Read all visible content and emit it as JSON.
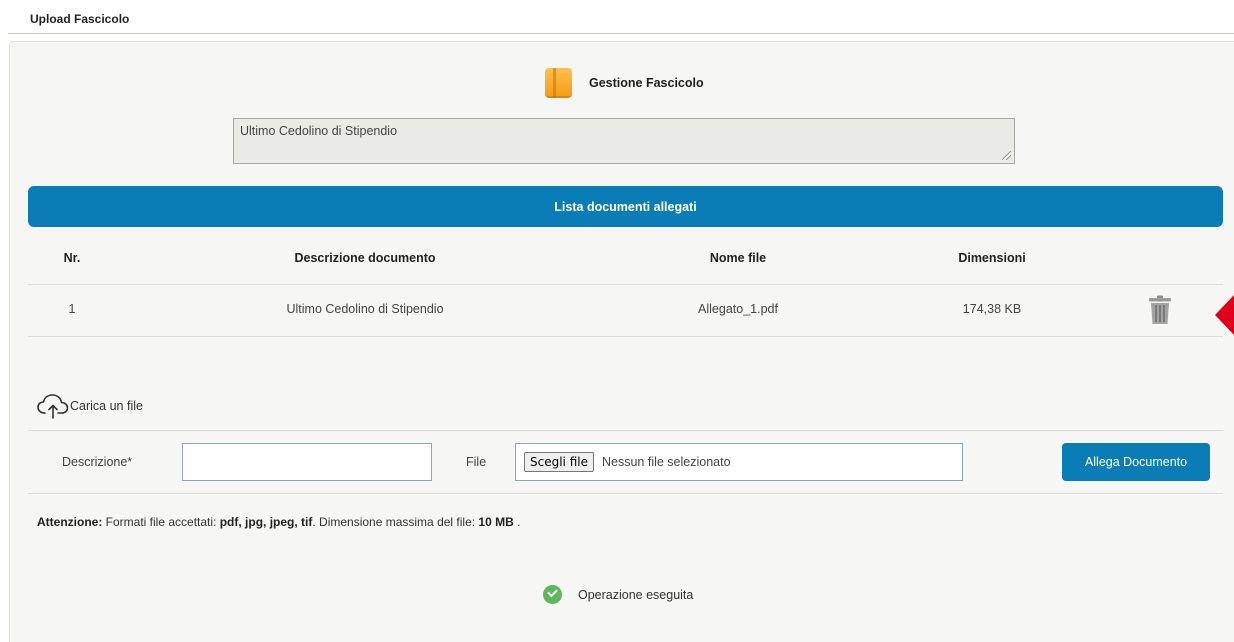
{
  "page": {
    "title": "Upload Fascicolo"
  },
  "gestione": {
    "title": "Gestione Fascicolo",
    "icon": "folder-icon"
  },
  "fascicolo_description": "Ultimo Cedolino di Stipendio",
  "lista": {
    "header": "Lista documenti allegati",
    "columns": [
      "Nr.",
      "Descrizione documento",
      "Nome file",
      "Dimensioni"
    ],
    "rows": [
      {
        "nr": "1",
        "descrizione": "Ultimo Cedolino di Stipendio",
        "nome_file": "Allegato_1.pdf",
        "dimensioni": "174,38 KB",
        "action_icon": "trash-icon"
      }
    ]
  },
  "upload": {
    "label": "Carica un file",
    "descrizione_label": "Descrizione*",
    "descrizione_value": "",
    "file_label": "File",
    "choose_button": "Scegli file",
    "file_status": "Nessun file selezionato",
    "attach_button": "Allega Documento"
  },
  "notice": {
    "prefix": "Attenzione:",
    "text1": " Formati file accettati: ",
    "formats": "pdf, jpg, jpeg, tif",
    "text2": ". Dimensione massima del file: ",
    "max_size": "10 MB",
    "text3": " ."
  },
  "status": {
    "message": "Operazione eseguita",
    "icon": "check-circle-icon"
  },
  "colors": {
    "accent": "#0a7cb6",
    "marker": "#e0001b",
    "success": "#5cb85c",
    "folder": "#f39c12"
  }
}
